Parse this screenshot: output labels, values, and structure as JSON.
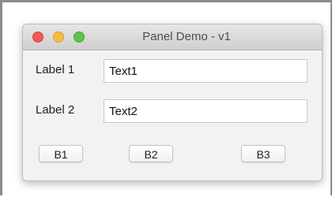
{
  "window": {
    "title": "Panel Demo - v1",
    "traffic_colors": {
      "close": "#ee5a56",
      "minimize": "#f2be3b",
      "maximize": "#5ec34b"
    }
  },
  "form": {
    "rows": [
      {
        "label": "Label 1",
        "value": "Text1"
      },
      {
        "label": "Label 2",
        "value": "Text2"
      }
    ]
  },
  "buttons": [
    "B1",
    "B2",
    "B3"
  ]
}
